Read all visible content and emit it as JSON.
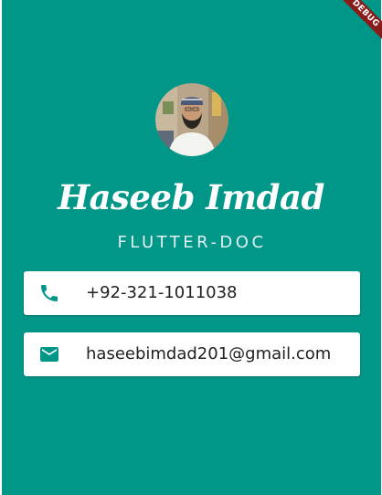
{
  "debug_banner": {
    "label": "DEBUG"
  },
  "profile": {
    "name": "Haseeb Imdad",
    "title": "FLUTTER-DOC"
  },
  "contacts": {
    "phone": {
      "icon": "phone-icon",
      "value": "+92-321-1011038"
    },
    "email": {
      "icon": "email-icon",
      "value": "haseebimdad201@gmail.com"
    }
  },
  "colors": {
    "background": "#009688",
    "card": "#ffffff",
    "icon": "#009688",
    "text": "#212121",
    "banner": "#8a1b1b"
  }
}
